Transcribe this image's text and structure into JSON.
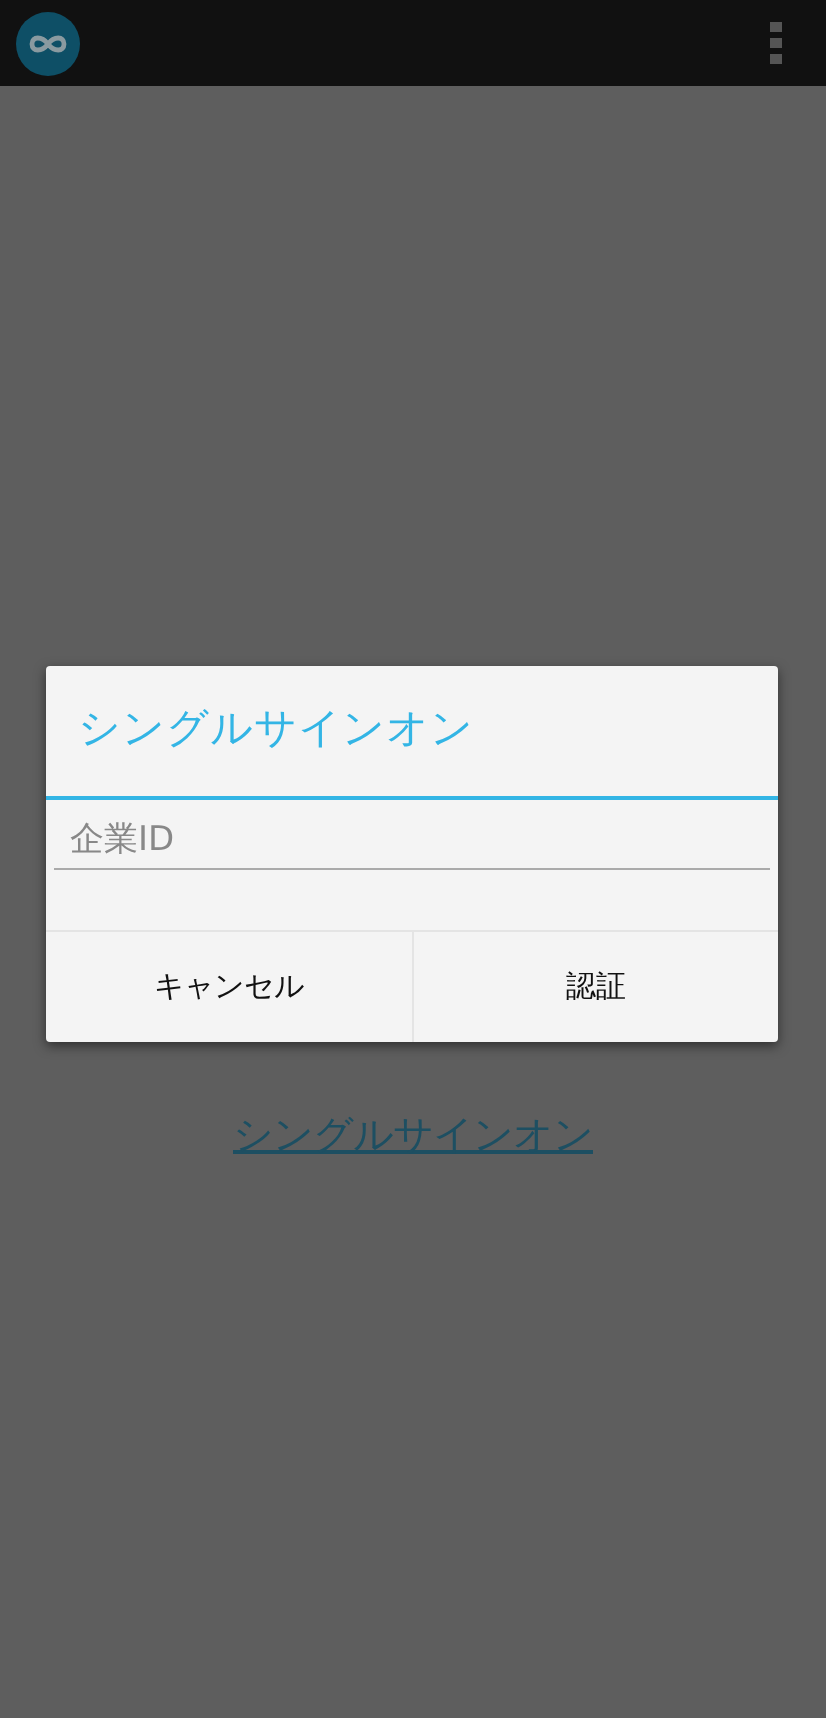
{
  "page": {
    "link": "シングルサインオン"
  },
  "dialog": {
    "title": "シングルサインオン",
    "field": {
      "placeholder": "企業ID"
    },
    "buttons": [
      "キャンセル",
      "認証"
    ]
  }
}
